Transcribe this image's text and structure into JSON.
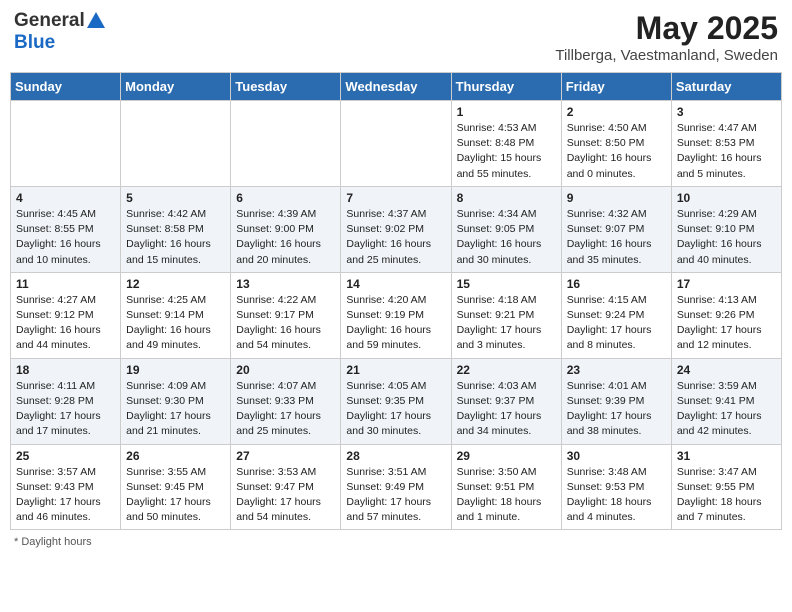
{
  "header": {
    "logo_general": "General",
    "logo_blue": "Blue",
    "month_year": "May 2025",
    "location": "Tillberga, Vaestmanland, Sweden"
  },
  "days_of_week": [
    "Sunday",
    "Monday",
    "Tuesday",
    "Wednesday",
    "Thursday",
    "Friday",
    "Saturday"
  ],
  "footer": {
    "daylight_label": "Daylight hours"
  },
  "weeks": [
    [
      {
        "day": "",
        "info": ""
      },
      {
        "day": "",
        "info": ""
      },
      {
        "day": "",
        "info": ""
      },
      {
        "day": "",
        "info": ""
      },
      {
        "day": "1",
        "info": "Sunrise: 4:53 AM\nSunset: 8:48 PM\nDaylight: 15 hours\nand 55 minutes."
      },
      {
        "day": "2",
        "info": "Sunrise: 4:50 AM\nSunset: 8:50 PM\nDaylight: 16 hours\nand 0 minutes."
      },
      {
        "day": "3",
        "info": "Sunrise: 4:47 AM\nSunset: 8:53 PM\nDaylight: 16 hours\nand 5 minutes."
      }
    ],
    [
      {
        "day": "4",
        "info": "Sunrise: 4:45 AM\nSunset: 8:55 PM\nDaylight: 16 hours\nand 10 minutes."
      },
      {
        "day": "5",
        "info": "Sunrise: 4:42 AM\nSunset: 8:58 PM\nDaylight: 16 hours\nand 15 minutes."
      },
      {
        "day": "6",
        "info": "Sunrise: 4:39 AM\nSunset: 9:00 PM\nDaylight: 16 hours\nand 20 minutes."
      },
      {
        "day": "7",
        "info": "Sunrise: 4:37 AM\nSunset: 9:02 PM\nDaylight: 16 hours\nand 25 minutes."
      },
      {
        "day": "8",
        "info": "Sunrise: 4:34 AM\nSunset: 9:05 PM\nDaylight: 16 hours\nand 30 minutes."
      },
      {
        "day": "9",
        "info": "Sunrise: 4:32 AM\nSunset: 9:07 PM\nDaylight: 16 hours\nand 35 minutes."
      },
      {
        "day": "10",
        "info": "Sunrise: 4:29 AM\nSunset: 9:10 PM\nDaylight: 16 hours\nand 40 minutes."
      }
    ],
    [
      {
        "day": "11",
        "info": "Sunrise: 4:27 AM\nSunset: 9:12 PM\nDaylight: 16 hours\nand 44 minutes."
      },
      {
        "day": "12",
        "info": "Sunrise: 4:25 AM\nSunset: 9:14 PM\nDaylight: 16 hours\nand 49 minutes."
      },
      {
        "day": "13",
        "info": "Sunrise: 4:22 AM\nSunset: 9:17 PM\nDaylight: 16 hours\nand 54 minutes."
      },
      {
        "day": "14",
        "info": "Sunrise: 4:20 AM\nSunset: 9:19 PM\nDaylight: 16 hours\nand 59 minutes."
      },
      {
        "day": "15",
        "info": "Sunrise: 4:18 AM\nSunset: 9:21 PM\nDaylight: 17 hours\nand 3 minutes."
      },
      {
        "day": "16",
        "info": "Sunrise: 4:15 AM\nSunset: 9:24 PM\nDaylight: 17 hours\nand 8 minutes."
      },
      {
        "day": "17",
        "info": "Sunrise: 4:13 AM\nSunset: 9:26 PM\nDaylight: 17 hours\nand 12 minutes."
      }
    ],
    [
      {
        "day": "18",
        "info": "Sunrise: 4:11 AM\nSunset: 9:28 PM\nDaylight: 17 hours\nand 17 minutes."
      },
      {
        "day": "19",
        "info": "Sunrise: 4:09 AM\nSunset: 9:30 PM\nDaylight: 17 hours\nand 21 minutes."
      },
      {
        "day": "20",
        "info": "Sunrise: 4:07 AM\nSunset: 9:33 PM\nDaylight: 17 hours\nand 25 minutes."
      },
      {
        "day": "21",
        "info": "Sunrise: 4:05 AM\nSunset: 9:35 PM\nDaylight: 17 hours\nand 30 minutes."
      },
      {
        "day": "22",
        "info": "Sunrise: 4:03 AM\nSunset: 9:37 PM\nDaylight: 17 hours\nand 34 minutes."
      },
      {
        "day": "23",
        "info": "Sunrise: 4:01 AM\nSunset: 9:39 PM\nDaylight: 17 hours\nand 38 minutes."
      },
      {
        "day": "24",
        "info": "Sunrise: 3:59 AM\nSunset: 9:41 PM\nDaylight: 17 hours\nand 42 minutes."
      }
    ],
    [
      {
        "day": "25",
        "info": "Sunrise: 3:57 AM\nSunset: 9:43 PM\nDaylight: 17 hours\nand 46 minutes."
      },
      {
        "day": "26",
        "info": "Sunrise: 3:55 AM\nSunset: 9:45 PM\nDaylight: 17 hours\nand 50 minutes."
      },
      {
        "day": "27",
        "info": "Sunrise: 3:53 AM\nSunset: 9:47 PM\nDaylight: 17 hours\nand 54 minutes."
      },
      {
        "day": "28",
        "info": "Sunrise: 3:51 AM\nSunset: 9:49 PM\nDaylight: 17 hours\nand 57 minutes."
      },
      {
        "day": "29",
        "info": "Sunrise: 3:50 AM\nSunset: 9:51 PM\nDaylight: 18 hours\nand 1 minute."
      },
      {
        "day": "30",
        "info": "Sunrise: 3:48 AM\nSunset: 9:53 PM\nDaylight: 18 hours\nand 4 minutes."
      },
      {
        "day": "31",
        "info": "Sunrise: 3:47 AM\nSunset: 9:55 PM\nDaylight: 18 hours\nand 7 minutes."
      }
    ]
  ]
}
